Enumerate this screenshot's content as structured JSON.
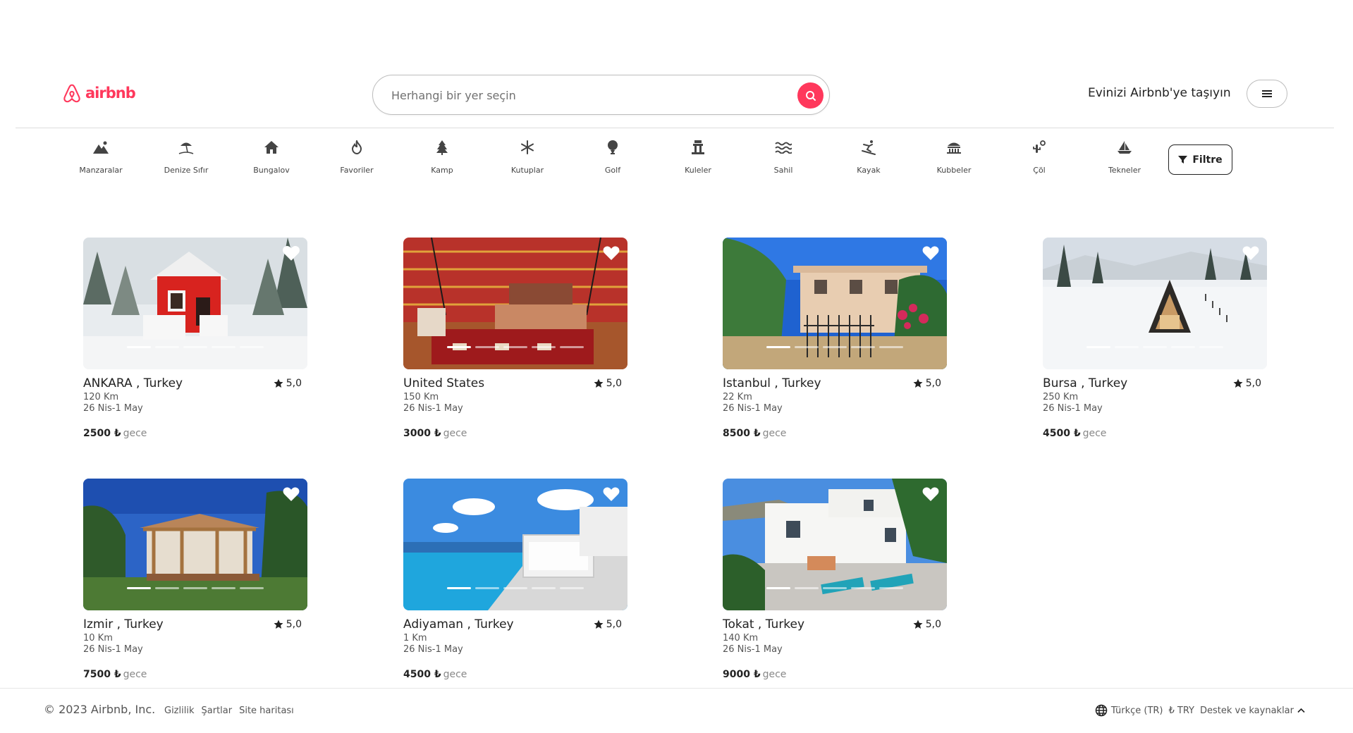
{
  "brand": {
    "name": "airbnb",
    "color": "#ff385c"
  },
  "header": {
    "search_placeholder": "Herhangi bir yer seçin",
    "host_link": "Evinizi Airbnb'ye taşıyın",
    "menu_icon": "hamburger-icon"
  },
  "categories": [
    {
      "label": "Manzaralar",
      "icon": "mountain-icon"
    },
    {
      "label": "Denize Sıfır",
      "icon": "beach-umbrella-icon"
    },
    {
      "label": "Bungalov",
      "icon": "house-icon"
    },
    {
      "label": "Favoriler",
      "icon": "fire-icon"
    },
    {
      "label": "Kamp",
      "icon": "tree-icon"
    },
    {
      "label": "Kutuplar",
      "icon": "snowflake-icon"
    },
    {
      "label": "Golf",
      "icon": "golf-icon"
    },
    {
      "label": "Kuleler",
      "icon": "tower-icon"
    },
    {
      "label": "Sahil",
      "icon": "waves-icon"
    },
    {
      "label": "Kayak",
      "icon": "skiing-icon"
    },
    {
      "label": "Kubbeler",
      "icon": "dome-icon"
    },
    {
      "label": "Çöl",
      "icon": "desert-icon"
    },
    {
      "label": "Tekneler",
      "icon": "sailboat-icon"
    }
  ],
  "filter_label": "Filtre",
  "listings": [
    {
      "title": "ANKARA , Turkey",
      "rating": "5,0",
      "distance": "120 Km",
      "dates": "26 Nis-1 May",
      "price": "2500 ₺",
      "unit": "gece",
      "image": "red-cabin-in-snow",
      "active_dot": 0
    },
    {
      "title": "United States",
      "rating": "5,0",
      "distance": "150 Km",
      "dates": "26 Nis-1 May",
      "price": "3000 ₺",
      "unit": "gece",
      "image": "red-tent-bedroom",
      "active_dot": 0
    },
    {
      "title": "Istanbul , Turkey",
      "rating": "5,0",
      "distance": "22 Km",
      "dates": "26 Nis-1 May",
      "price": "8500 ₺",
      "unit": "gece",
      "image": "stone-house-with-gate",
      "active_dot": 0
    },
    {
      "title": "Bursa , Turkey",
      "rating": "5,0",
      "distance": "250 Km",
      "dates": "26 Nis-1 May",
      "price": "4500 ₺",
      "unit": "gece",
      "image": "a-frame-in-snow",
      "active_dot": 0
    },
    {
      "title": "Izmir , Turkey",
      "rating": "5,0",
      "distance": "10 Km",
      "dates": "26 Nis-1 May",
      "price": "7500 ₺",
      "unit": "gece",
      "image": "garden-pergola-house",
      "active_dot": 0
    },
    {
      "title": "Adiyaman , Turkey",
      "rating": "5,0",
      "distance": "1 Km",
      "dates": "26 Nis-1 May",
      "price": "4500 ₺",
      "unit": "gece",
      "image": "infinity-pool-villa",
      "active_dot": 0
    },
    {
      "title": "Tokat , Turkey",
      "rating": "5,0",
      "distance": "140 Km",
      "dates": "26 Nis-1 May",
      "price": "9000 ₺",
      "unit": "gece",
      "image": "white-terrace-house",
      "active_dot": 0
    }
  ],
  "footer": {
    "copyright": "© 2023 Airbnb, Inc.",
    "links": [
      "Gizlilik",
      "Şartlar",
      "Site haritası"
    ],
    "language": "Türkçe (TR)",
    "currency": "₺ TRY",
    "support": "Destek ve kaynaklar"
  }
}
